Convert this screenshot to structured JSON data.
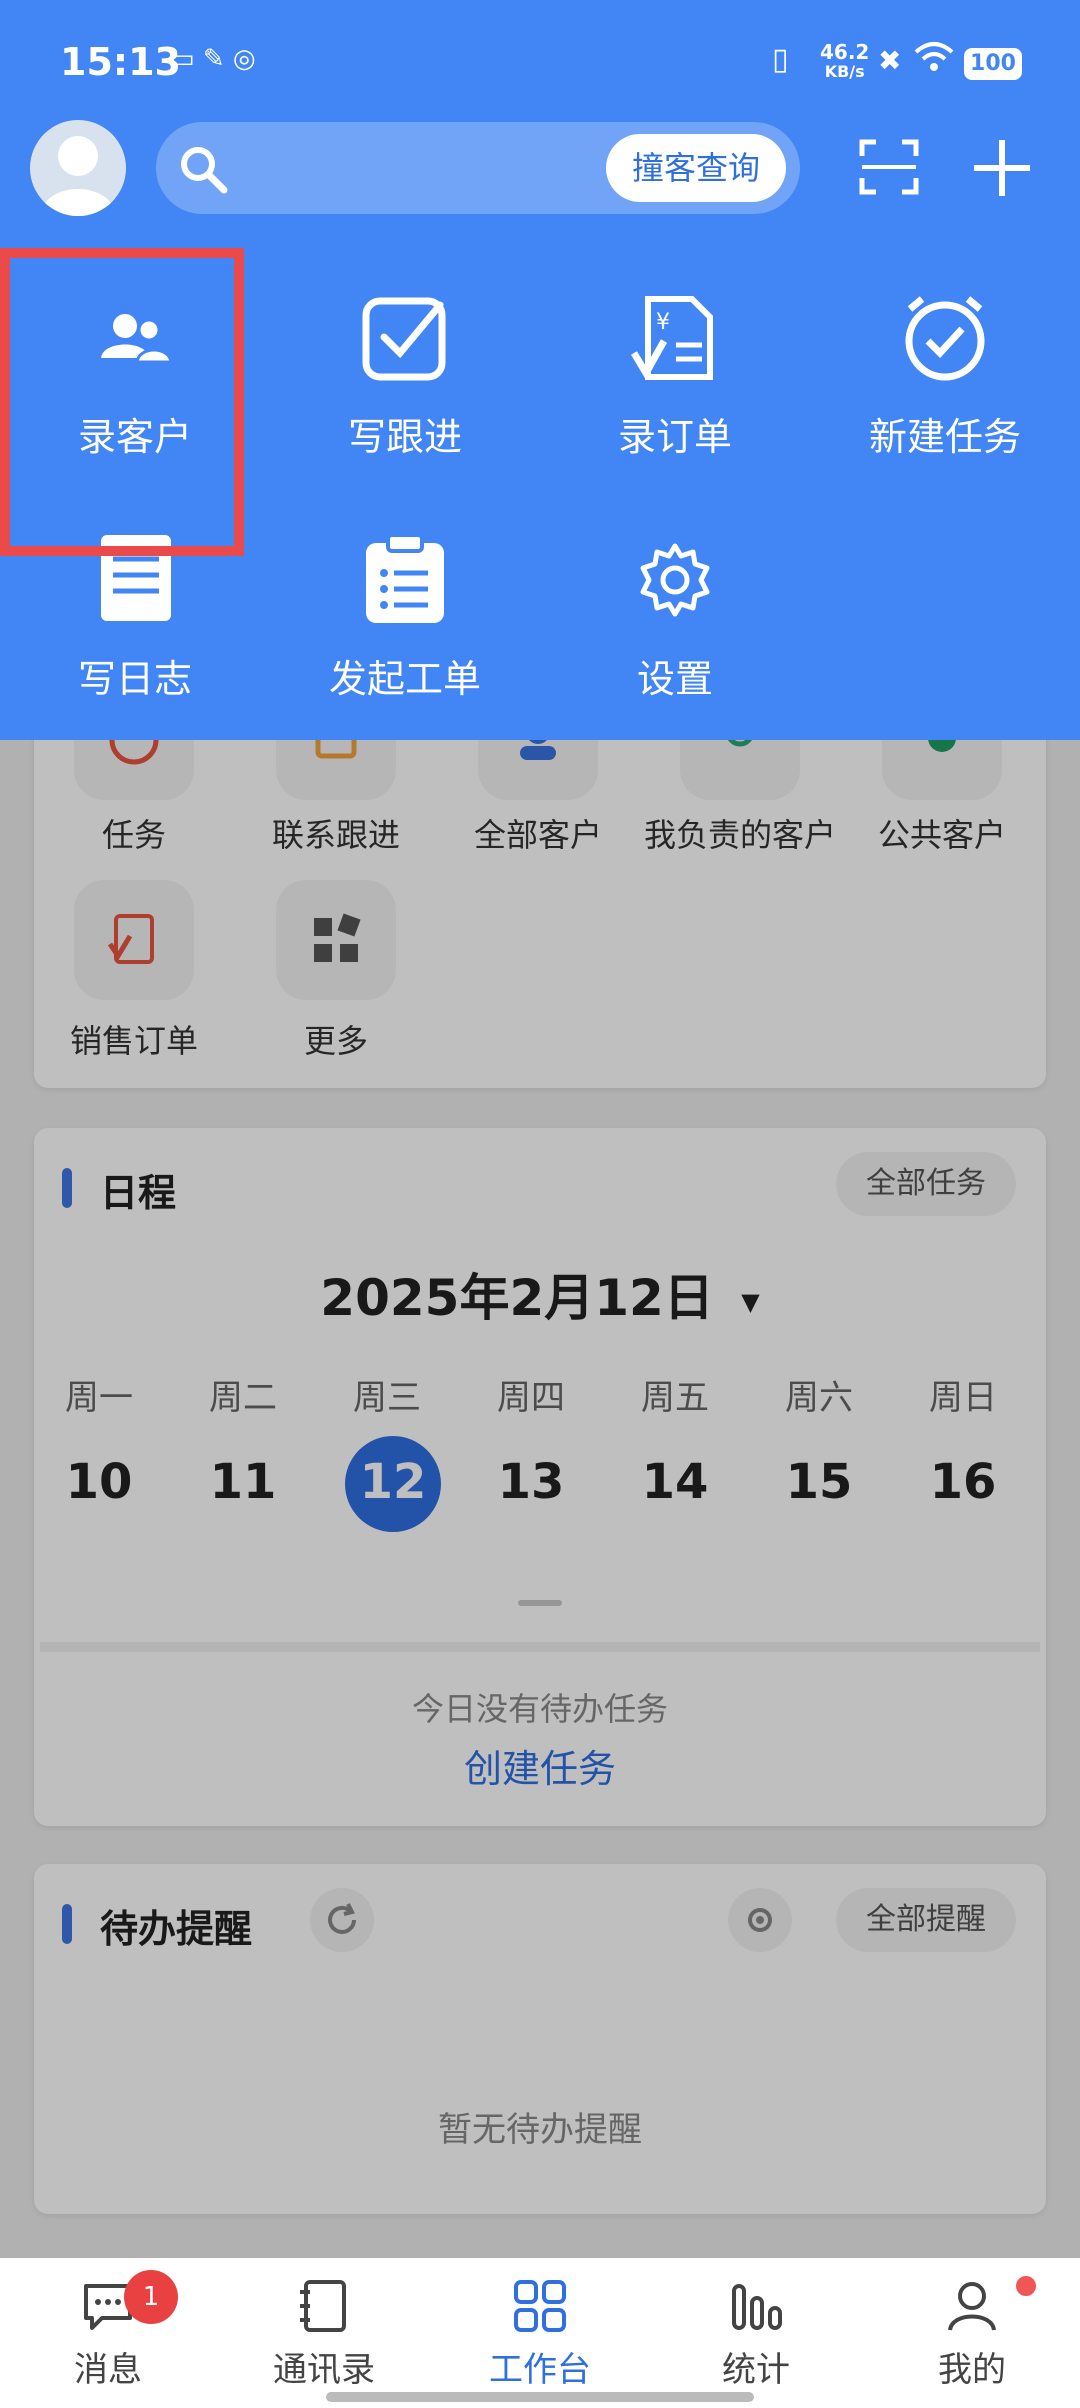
{
  "status_bar": {
    "time": "15:13",
    "net_speed_top": "46.2",
    "net_speed_unit": "KB/s",
    "battery": "100"
  },
  "header": {
    "search_placeholder": "",
    "lookup_button": "撞客查询",
    "scan_icon": "scan-icon",
    "add_icon": "plus-icon"
  },
  "quick_actions": [
    {
      "label": "录客户",
      "icon": "users-icon"
    },
    {
      "label": "写跟进",
      "icon": "checkbox-icon"
    },
    {
      "label": "录订单",
      "icon": "order-icon"
    },
    {
      "label": "新建任务",
      "icon": "alarm-icon"
    },
    {
      "label": "写日志",
      "icon": "notebook-icon"
    },
    {
      "label": "发起工单",
      "icon": "clipboard-icon"
    },
    {
      "label": "设置",
      "icon": "gear-icon"
    }
  ],
  "apps": {
    "row1": [
      "任务",
      "联系跟进",
      "全部客户",
      "我负责的客户",
      "公共客户"
    ],
    "row2": [
      "销售订单",
      "更多"
    ]
  },
  "schedule": {
    "title": "日程",
    "all_button": "全部任务",
    "date_label": "2025年2月12日",
    "weekdays": [
      "周一",
      "周二",
      "周三",
      "周四",
      "周五",
      "周六",
      "周日"
    ],
    "days": [
      "10",
      "11",
      "12",
      "13",
      "14",
      "15",
      "16"
    ],
    "selected_index": 2,
    "empty_text": "今日没有待办任务",
    "create_link": "创建任务"
  },
  "reminders": {
    "title": "待办提醒",
    "all_button": "全部提醒",
    "empty_text": "暂无待办提醒"
  },
  "nav": {
    "items": [
      {
        "label": "消息",
        "icon": "chat-icon",
        "badge": "1"
      },
      {
        "label": "通讯录",
        "icon": "contacts-icon"
      },
      {
        "label": "工作台",
        "icon": "grid-icon",
        "active": true
      },
      {
        "label": "统计",
        "icon": "stats-icon"
      },
      {
        "label": "我的",
        "icon": "person-icon"
      }
    ]
  },
  "colors": {
    "brand": "#4285f4",
    "highlight": "#ea4a4a",
    "active_nav": "#2f6fe0",
    "badge": "#e94141"
  }
}
